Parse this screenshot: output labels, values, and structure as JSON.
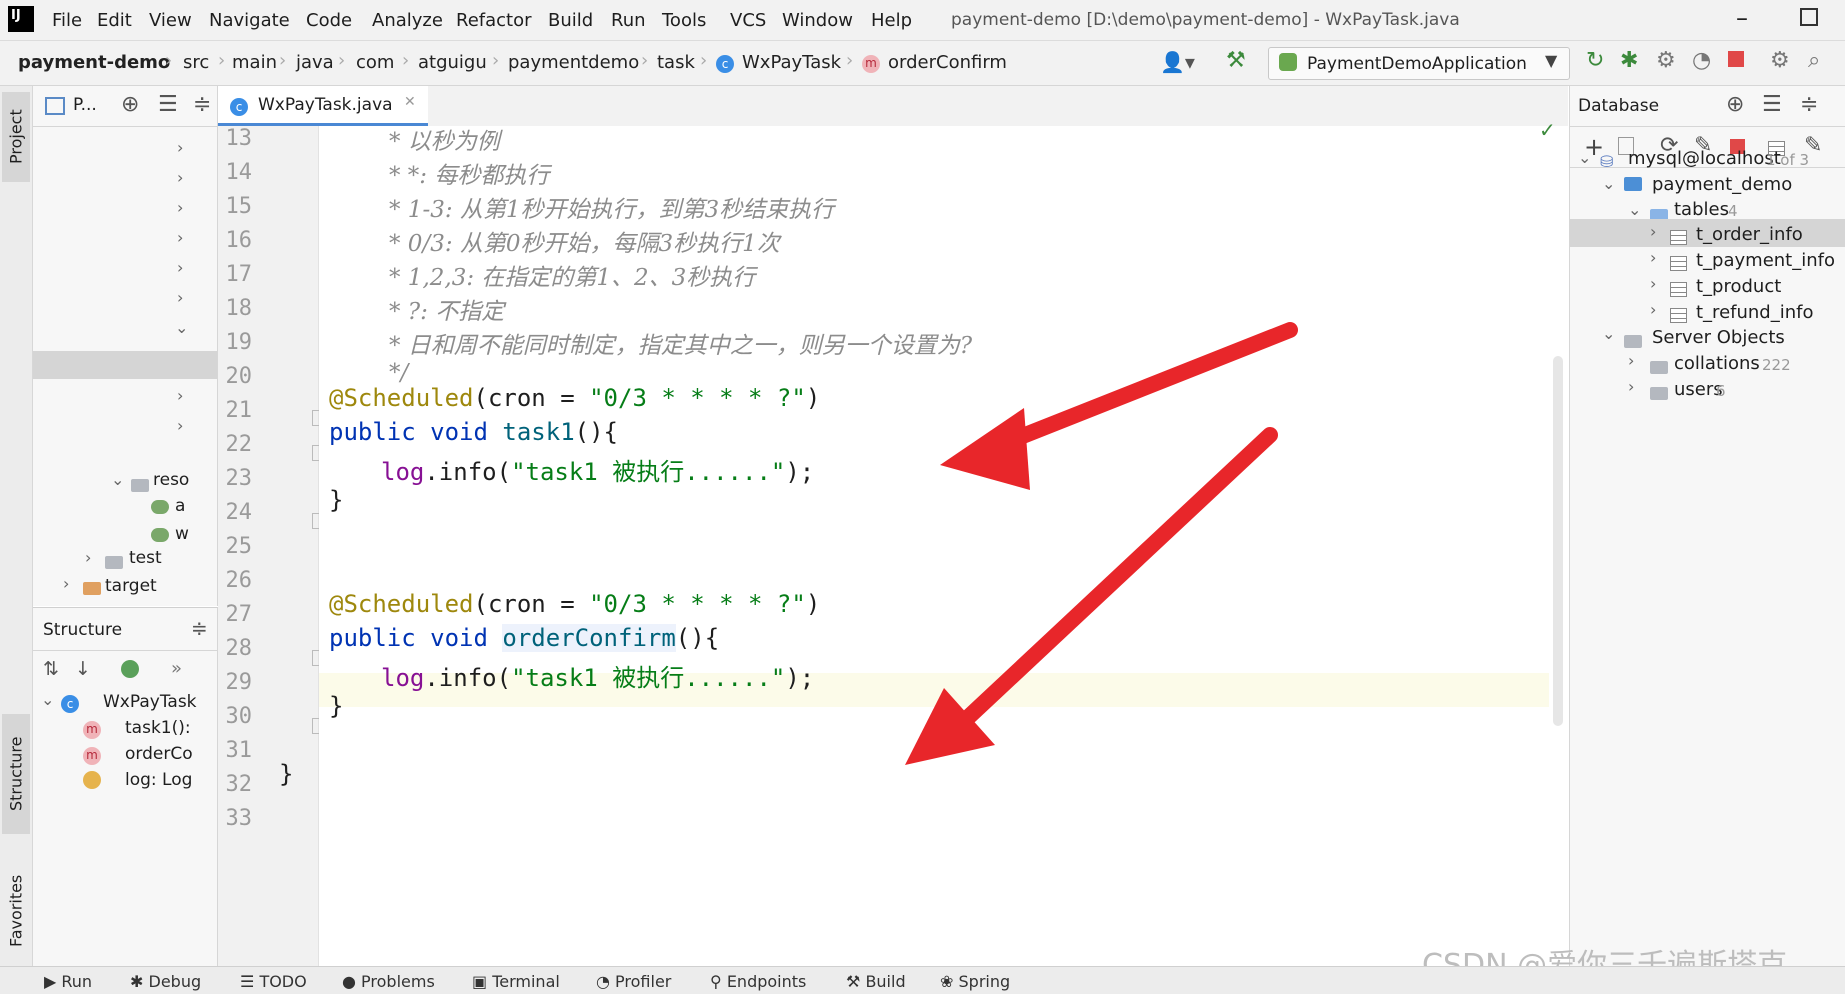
{
  "menu": {
    "app_logo": "IJ",
    "items": [
      "File",
      "Edit",
      "View",
      "Navigate",
      "Code",
      "Analyze",
      "Refactor",
      "Build",
      "Run",
      "Tools",
      "VCS",
      "Window",
      "Help"
    ],
    "window_title": "payment-demo [D:\\demo\\payment-demo] - WxPayTask.java"
  },
  "breadcrumb": [
    "payment-demo",
    "src",
    "main",
    "java",
    "com",
    "atguigu",
    "paymentdemo",
    "task",
    "WxPayTask",
    "orderConfirm"
  ],
  "run_config": "PaymentDemoApplication",
  "stripe": {
    "project": "Project",
    "structure": "Structure",
    "favorites": "Favorites"
  },
  "project_panel": {
    "header": "P...",
    "items": [
      "reso",
      "a",
      "w",
      "test",
      "target"
    ]
  },
  "structure_panel": {
    "title": "Structure",
    "items": [
      "WxPayTask",
      "task1():",
      "orderCo",
      "log: Log"
    ]
  },
  "editor": {
    "tab_label": "WxPayTask.java",
    "line_numbers": [
      "13",
      "14",
      "15",
      "16",
      "17",
      "18",
      "19",
      "20",
      "21",
      "22",
      "23",
      "24",
      "25",
      "26",
      "27",
      "28",
      "29",
      "30",
      "31",
      "32",
      "33"
    ],
    "comments": [
      "* 以秒为例",
      "* *: 每秒都执行",
      "* 1-3: 从第1秒开始执行，到第3秒结束执行",
      "* 0/3: 从第0秒开始，每隔3秒执行1次",
      "* 1,2,3: 在指定的第1、2、3秒执行",
      "* ?: 不指定",
      "* 日和周不能同时制定，指定其中之一，则另一个设置为?",
      "*/"
    ],
    "annotation": "@Scheduled",
    "cron_key": "(cron = ",
    "cron_value": "\"0/3 * * * * ?\"",
    "paren_close": ")",
    "kw_public": "public",
    "kw_void": "void",
    "method1": "task1",
    "method2": "orderConfirm",
    "sig_tail": "(){",
    "log_field": "log",
    "log_call": ".info(",
    "log_string": "\"task1 被执行......\"",
    "log_tail": ");",
    "brace_close": "}"
  },
  "database": {
    "title": "Database",
    "connection": "mysql@localhost",
    "connection_count": "1 of 3",
    "schema": "payment_demo",
    "tables_label": "tables",
    "tables_count": "4",
    "tables": [
      "t_order_info",
      "t_payment_info",
      "t_product",
      "t_refund_info"
    ],
    "server_objects": "Server Objects",
    "collations": "collations",
    "collations_count": "222",
    "users": "users",
    "users_count": "6"
  },
  "bottom_tabs": [
    "Run",
    "Debug",
    "TODO",
    "Problems",
    "Terminal",
    "Profiler",
    "Endpoints",
    "Build",
    "Spring"
  ],
  "watermark": "CSDN @爱你三千遍斯塔克",
  "colors": {
    "arrow": "#e8262a",
    "keyword": "#0033b3",
    "string": "#067d17",
    "annotation": "#9e880d"
  }
}
